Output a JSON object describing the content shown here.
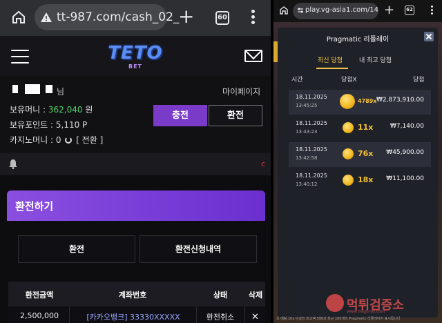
{
  "left": {
    "browser": {
      "url": "tt-987.com/cash_02_",
      "tab_count": "60"
    },
    "site": {
      "logo": "TETO",
      "logo_sub": "BET"
    },
    "user": {
      "name_suffix": "님",
      "mypage": "마이페이지",
      "money_label": "보유머니 :",
      "money_value": "362,040",
      "money_unit": "원",
      "point_label": "보유포인트 :",
      "point_value": "5,110 P",
      "casino_label": "카지노머니 :",
      "casino_value": "0",
      "convert_label": "[ 전환 ]"
    },
    "buttons": {
      "charge": "충전",
      "exchange": "환전"
    },
    "notice": {
      "mark": "c"
    },
    "exchange": {
      "title": "환전하기",
      "tab_exchange": "환전",
      "tab_history": "환전신청내역"
    },
    "table": {
      "headers": [
        "환전금액",
        "계좌번호",
        "상태",
        "삭제"
      ],
      "row": {
        "amount": "2,500,000",
        "account": "[카카오뱅크] 33330XXXXX",
        "status": "환전취소",
        "delete": "✕"
      }
    }
  },
  "right": {
    "browser": {
      "url": "play.vg-asia1.com/14",
      "tab_count": "62"
    },
    "modal": {
      "title": "Pragmatic 리플레이",
      "tab_latest": "최신 당첨",
      "tab_top": "내 최고 당첨",
      "col_time": "시간",
      "col_mult": "당첨X",
      "col_win": "당첨"
    },
    "records": [
      {
        "date": "18.11.2025",
        "time": "13:45:25",
        "mult": "4789x",
        "amount": "₩2,873,910.00"
      },
      {
        "date": "18.11.2025",
        "time": "13:43:23",
        "mult": "11x",
        "amount": "₩7,140.00"
      },
      {
        "date": "18.11.2025",
        "time": "13:42:58",
        "mult": "76x",
        "amount": "₩45,900.00"
      },
      {
        "date": "18.11.2025",
        "time": "13:40:12",
        "mult": "18x",
        "amount": "₩11,100.00"
      }
    ],
    "footer": "초 배팅 10x 이상인 최고액 당첨과 최근 100개의 Pragmatic 리플레이어 표시됩니다"
  },
  "watermark": {
    "text": "먹튀검증소",
    "sub": "www.mtgu-so.com"
  }
}
